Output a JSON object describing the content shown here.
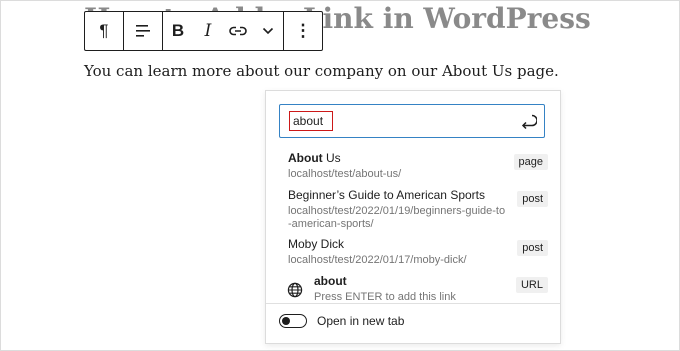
{
  "post": {
    "title": "How to Add a Link in WordPress",
    "paragraph": "You can learn more about our company on our About Us page."
  },
  "toolbar": {
    "items": [
      {
        "icon": "paragraph-icon",
        "glyph": "¶"
      },
      {
        "icon": "align-icon"
      },
      {
        "icon": "bold-icon",
        "glyph": "B"
      },
      {
        "icon": "italic-icon",
        "glyph": "I"
      },
      {
        "icon": "link-icon"
      },
      {
        "icon": "chevron-down-icon"
      },
      {
        "icon": "more-options-icon",
        "glyph": "⋮"
      }
    ]
  },
  "link_popover": {
    "search": {
      "value": "about"
    },
    "results": [
      {
        "title_bold": "About",
        "title_rest": " Us",
        "url": "localhost/test/about-us/",
        "type": "page"
      },
      {
        "title_bold": "",
        "title_rest": "Beginner’s Guide to American Sports",
        "url": "localhost/test/2022/01/19/beginners-guide-to-american-sports/",
        "url_line1": "localhost/test/2022/01/19/beginners-guide-to",
        "url_line2": "-american-sports/",
        "type": "post"
      },
      {
        "title_bold": "",
        "title_rest": "Moby Dick",
        "url": "localhost/test/2022/01/17/moby-dick/",
        "type": "post"
      },
      {
        "title_bold": "about",
        "title_rest": "",
        "hint": "Press ENTER to add this link",
        "type": "URL"
      }
    ],
    "new_tab_label": "Open in new tab",
    "new_tab_enabled": false
  },
  "colors": {
    "focus": "#3582c4",
    "highlight": "#cc1818",
    "muted": "#757575"
  }
}
